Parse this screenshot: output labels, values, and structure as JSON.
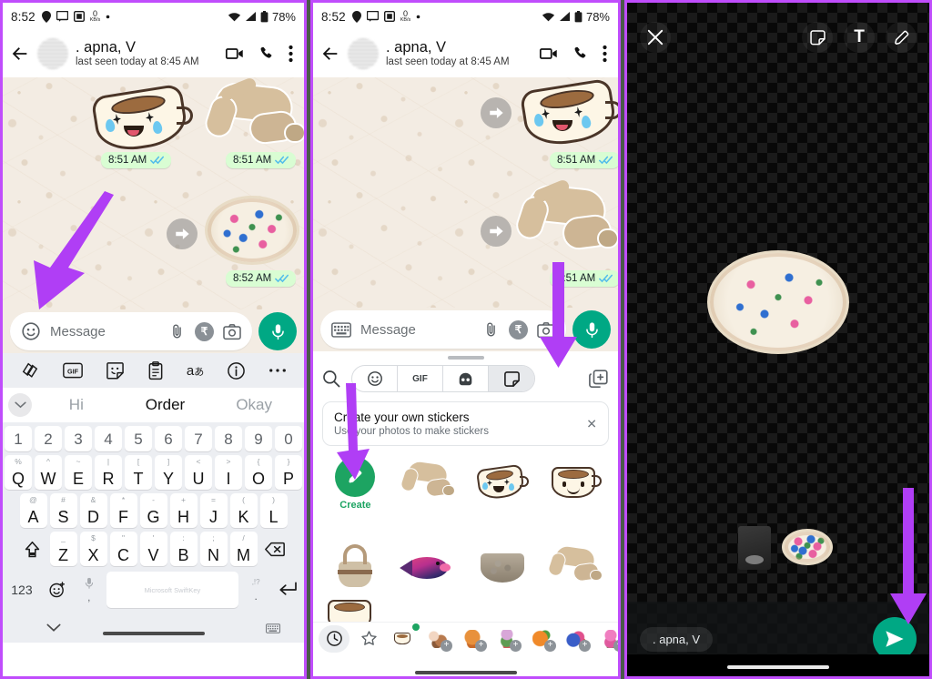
{
  "statusbar": {
    "time": "8:52",
    "battery": "78%",
    "data_rate": "0",
    "data_unit": "KB/s",
    "icons": [
      "location-icon",
      "message-icon",
      "screenshot-icon",
      "data-speed-icon",
      "dot-icon",
      "wifi-icon",
      "signal-icon",
      "battery-icon"
    ]
  },
  "chat_header": {
    "name": ". apna, V",
    "status": "last seen today at 8:45 AM",
    "icons": [
      "back-arrow-icon",
      "avatar",
      "video-call-icon",
      "voice-call-icon",
      "overflow-menu-icon"
    ]
  },
  "panel1": {
    "messages": [
      {
        "type": "sticker",
        "art": "crying-laugh-coffee-cup",
        "time": "8:51 AM",
        "status": "read"
      },
      {
        "type": "sticker",
        "art": "cat-dive",
        "time": "8:51 AM",
        "status": "read"
      },
      {
        "type": "sticker",
        "art": "floral-embroidery-placemat",
        "time": "8:52 AM",
        "status": "read"
      }
    ],
    "input": {
      "leading_icon": "emoji-icon",
      "placeholder": "Message",
      "attach_icon": "paperclip-icon",
      "payment_icon": "rupee-icon",
      "camera_icon": "camera-icon",
      "mic_icon": "microphone-icon"
    },
    "swiftkey_toolbar": [
      "swiftkey-logo-icon",
      "gif-icon",
      "sticker-icon",
      "clipboard-icon",
      "translate-icon",
      "info-icon",
      "more-icon"
    ],
    "suggestions": [
      "Hi",
      "Order",
      "Okay"
    ],
    "keyboard": {
      "numbers": [
        "1",
        "2",
        "3",
        "4",
        "5",
        "6",
        "7",
        "8",
        "9",
        "0"
      ],
      "row1": [
        {
          "main": "Q",
          "sub": "%"
        },
        {
          "main": "W",
          "sub": "^"
        },
        {
          "main": "E",
          "sub": "~"
        },
        {
          "main": "R",
          "sub": "|"
        },
        {
          "main": "T",
          "sub": "["
        },
        {
          "main": "Y",
          "sub": "]"
        },
        {
          "main": "U",
          "sub": "<"
        },
        {
          "main": "I",
          "sub": ">"
        },
        {
          "main": "O",
          "sub": "{"
        },
        {
          "main": "P",
          "sub": "}"
        }
      ],
      "row2": [
        {
          "main": "A",
          "sub": "@"
        },
        {
          "main": "S",
          "sub": "#"
        },
        {
          "main": "D",
          "sub": "&"
        },
        {
          "main": "F",
          "sub": "*"
        },
        {
          "main": "G",
          "sub": "-"
        },
        {
          "main": "H",
          "sub": "+"
        },
        {
          "main": "J",
          "sub": "="
        },
        {
          "main": "K",
          "sub": "("
        },
        {
          "main": "L",
          "sub": ")"
        }
      ],
      "row3": [
        {
          "main": "Z",
          "sub": "_"
        },
        {
          "main": "X",
          "sub": "$"
        },
        {
          "main": "C",
          "sub": "\""
        },
        {
          "main": "V",
          "sub": "'"
        },
        {
          "main": "B",
          "sub": ":"
        },
        {
          "main": "N",
          "sub": ";"
        },
        {
          "main": "M",
          "sub": "/"
        }
      ],
      "shift_icon": "shift-icon",
      "backspace_icon": "backspace-icon",
      "numeric_key": "123",
      "emoji_key_icon": "emoji-keyboard-icon",
      "mic_key_icon": "microphone-icon",
      "comma_key": ",",
      "space_label": "Microsoft SwiftKey",
      "period_key": ".",
      "punct_key": ",!?",
      "enter_icon": "enter-icon",
      "collapse_icon": "chevron-down-icon",
      "resize_icon": "keyboard-resize-icon"
    }
  },
  "panel2": {
    "input": {
      "leading_icon": "keyboard-icon",
      "placeholder": "Message",
      "attach_icon": "paperclip-icon",
      "payment_icon": "rupee-icon",
      "camera_icon": "camera-icon",
      "mic_icon": "microphone-icon"
    },
    "messages": [
      {
        "type": "sticker",
        "art": "crying-laugh-coffee-cup",
        "time": "8:51 AM",
        "status": "read"
      },
      {
        "type": "sticker",
        "art": "cat-dive",
        "time": "8:51 AM",
        "status": "read"
      }
    ],
    "sticker_panel": {
      "search_icon": "search-icon",
      "tabs": [
        {
          "id": "emoji",
          "icon": "emoji-icon",
          "label": "",
          "active": false
        },
        {
          "id": "gif",
          "icon": "gif-icon",
          "label": "GIF",
          "active": false
        },
        {
          "id": "avatar",
          "icon": "avatar-icon",
          "label": "",
          "active": false
        },
        {
          "id": "sticker",
          "icon": "sticker-icon",
          "label": "",
          "active": true
        }
      ],
      "add_pack_icon": "add-sticker-pack-icon",
      "banner": {
        "title": "Create your own stickers",
        "subtitle": "Use your photos to make stickers",
        "close_icon": "close-icon"
      },
      "create_button": {
        "label": "Create",
        "icon": "pencil-icon",
        "color": "#1da462"
      },
      "stickers": [
        "cat-dive",
        "crying-laugh-coffee-cup",
        "smiling-coffee-cup",
        "woven-basket",
        "colorful-fish",
        "bread-bowl",
        "cat-dive-2",
        "coffee-cup-partial"
      ],
      "tray": [
        {
          "icon": "recent-clock-icon",
          "active": true,
          "plus": false
        },
        {
          "icon": "favorites-star-icon",
          "active": false,
          "plus": false
        },
        {
          "icon": "coffee-pack-icon",
          "active": false,
          "plus": false,
          "badge": true
        },
        {
          "icon": "pack-1-icon",
          "active": false,
          "plus": true
        },
        {
          "icon": "pack-2-icon",
          "active": false,
          "plus": true
        },
        {
          "icon": "pack-3-icon",
          "active": false,
          "plus": true
        },
        {
          "icon": "pack-4-icon",
          "active": false,
          "plus": true
        },
        {
          "icon": "pack-5-icon",
          "active": false,
          "plus": true
        },
        {
          "icon": "pack-6-icon",
          "active": false,
          "plus": true
        },
        {
          "icon": "pack-7-icon",
          "active": false,
          "plus": true
        }
      ]
    }
  },
  "panel3": {
    "editor": {
      "close_icon": "close-icon",
      "tools": [
        "sticker-tool-icon",
        "text-tool-icon",
        "pencil-tool-icon"
      ],
      "canvas_sticker": "floral-embroidery-placemat",
      "thumbnails": [
        "dark-card-thumbnail",
        "floral-placemat-thumbnail"
      ],
      "recipient_chip": ". apna, V",
      "send_icon": "send-icon",
      "send_color": "#00a884"
    }
  },
  "annotations": {
    "color": "#b03ef5",
    "arrows": [
      {
        "id": "arrow-emoji-button",
        "panel": 1,
        "target": "emoji-icon"
      },
      {
        "id": "arrow-sticker-tab",
        "panel": 2,
        "target": "sticker-tab"
      },
      {
        "id": "arrow-create-button",
        "panel": 2,
        "target": "create-button"
      },
      {
        "id": "arrow-send-button",
        "panel": 3,
        "target": "send-button"
      }
    ]
  }
}
